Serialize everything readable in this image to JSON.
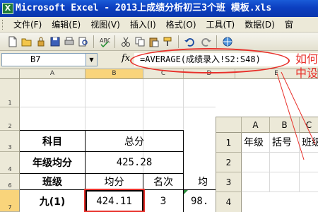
{
  "window": {
    "app_icon": "excel-icon",
    "title": "Microsoft Excel - 2013上成绩分析初三3个班 模板.xls"
  },
  "menu": {
    "items": [
      "文件(F)",
      "编辑(E)",
      "视图(V)",
      "插入(I)",
      "格式(O)",
      "工具(T)",
      "数据(D)",
      "窗"
    ]
  },
  "toolbar": {
    "icons": [
      "new-icon",
      "open-icon",
      "permission-icon",
      "save-icon",
      "print-icon",
      "print-preview-icon",
      "spelling-icon",
      "cut-icon",
      "copy-icon",
      "paste-icon",
      "format-painter-icon",
      "undo-icon",
      "redo-icon",
      "hyperlink-icon"
    ]
  },
  "formula_bar": {
    "name_box": "B7",
    "fx_label": "fx",
    "formula": "=AVERAGE(成绩录入!S2:S48)"
  },
  "sheet": {
    "columns": [
      "A",
      "B",
      "C",
      "D",
      "E"
    ],
    "rows": [
      "1",
      "2",
      "3",
      "4",
      "6",
      "7"
    ],
    "selected_column": "B",
    "selected_row": "7",
    "cells": {
      "subject_label": "科目",
      "total_header": "总分",
      "grade_avg_label": "年级均分",
      "grade_avg_value": "425.28",
      "class_label": "班级",
      "avg_label": "均分",
      "rank_label": "名次",
      "next_label": "均",
      "class_name": "九(1)",
      "class_avg": "424.11",
      "class_rank": "3",
      "next_value": "98."
    }
  },
  "inset": {
    "columns": [
      "A",
      "B",
      "C"
    ],
    "rows": [
      "1",
      "2",
      "3",
      "4"
    ],
    "headers": [
      "年级",
      "括号",
      "班级"
    ]
  },
  "annotation": {
    "line1": "如何",
    "line2": "中设"
  },
  "colors": {
    "accent_red": "#e8302a",
    "title_blue": "#0c3fc0",
    "selection_orange": "#f9d47b"
  }
}
